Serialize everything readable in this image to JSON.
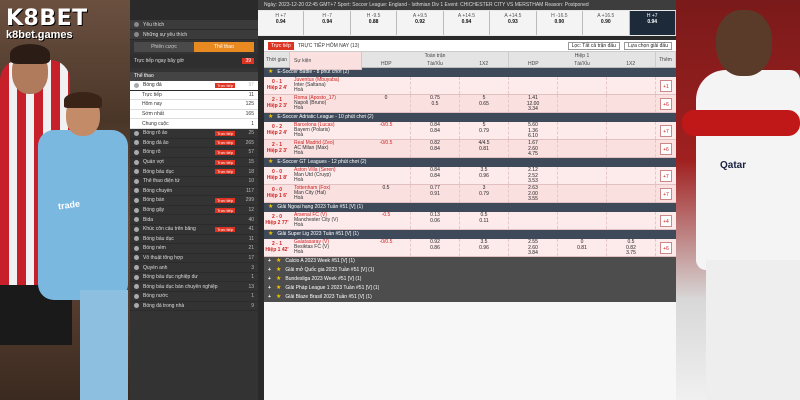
{
  "brand": {
    "name_k8": "K8",
    "name_bet": "BET",
    "domain": "k8bet.games"
  },
  "photo": {
    "left_sponsor": "trade",
    "right_sponsor": "Qatar"
  },
  "topbar": {
    "info": "Ngày: 2023-12-20 02:45 GMT+7 Sport: Soccer League: England - Isthmian Div 1 Event: CHICHESTER CITY VS MERSTHAM Reason: Postponed",
    "odds": [
      {
        "l": "H +7",
        "v": "0.94"
      },
      {
        "l": "H -7",
        "v": "0.94"
      },
      {
        "l": "H -9.5",
        "v": "0.88"
      },
      {
        "l": "A +9.5",
        "v": "0.92"
      },
      {
        "l": "A +14.5",
        "v": "0.94"
      },
      {
        "l": "A +14.5",
        "v": "0.93"
      },
      {
        "l": "H -16.5",
        "v": "0.90"
      },
      {
        "l": "A +16.5",
        "v": "0.90"
      },
      {
        "l": "H +7",
        "v": "0.94"
      }
    ]
  },
  "sidebar": {
    "favorites": "Yêu thích",
    "favorite_sports": "Những sự yêu thích",
    "tab_left": "Phiên cược",
    "tab_right": "Thể thao",
    "live_label": "Trực tiếp ngay bây giờ",
    "live_count": "39",
    "section": "Thể thao",
    "sport_selected": {
      "name": "Bóng đá",
      "live": "Trực tiếp",
      "count": "97"
    },
    "sub_items": [
      {
        "name": "Trực tiếp",
        "count": "11"
      },
      {
        "name": "Hôm nay",
        "count": "125"
      },
      {
        "name": "Sớm nhất",
        "count": "165"
      },
      {
        "name": "Chung cuộc",
        "count": "1"
      }
    ],
    "sports": [
      {
        "name": "Bóng rổ ảo",
        "live": "Trực tiếp",
        "count": "25"
      },
      {
        "name": "Bóng đá ảo",
        "live": "Trực tiếp",
        "count": "265"
      },
      {
        "name": "Bóng rổ",
        "live": "Trực tiếp",
        "count": "57"
      },
      {
        "name": "Quần vợt",
        "live": "Trực tiếp",
        "count": "15"
      },
      {
        "name": "Bóng bầu dục",
        "live": "Trực tiếp",
        "count": "18"
      },
      {
        "name": "Thể thao điện tử",
        "live": "",
        "count": "10"
      },
      {
        "name": "Bóng chuyền",
        "live": "",
        "count": "117"
      },
      {
        "name": "Bóng bàn",
        "live": "Trực tiếp",
        "count": "299"
      },
      {
        "name": "Bóng gậy",
        "live": "Trực tiếp",
        "count": "12"
      },
      {
        "name": "Bida",
        "live": "",
        "count": "40"
      },
      {
        "name": "Khúc côn cầu trên băng",
        "live": "Trực tiếp",
        "count": "41"
      },
      {
        "name": "Bóng bầu dục",
        "live": "",
        "count": "11"
      },
      {
        "name": "Bóng ném",
        "live": "",
        "count": "21"
      },
      {
        "name": "Vô thuật tổng hợp",
        "live": "",
        "count": "17"
      },
      {
        "name": "Quyền anh",
        "live": "",
        "count": "3"
      },
      {
        "name": "Bóng bầu dục nghiệp dư",
        "live": "",
        "count": "1"
      },
      {
        "name": "Bóng bầu dục bán chuyên nghiệp",
        "live": "",
        "count": "13"
      },
      {
        "name": "Bóng nước",
        "live": "",
        "count": "1"
      },
      {
        "name": "Bóng đá trong nhà",
        "live": "",
        "count": "9"
      }
    ]
  },
  "main": {
    "live_btn": "Trực tiếp",
    "title": "TRỰC TIẾP HÔM NAY (13)",
    "select": "Lọc: Tất cả trận đấu",
    "filter": "Lựa chọn giải đấu",
    "col_time": "Thời gian",
    "col_match": "Sự kiện",
    "col_ft": "Toàn trận",
    "col_h1": "Hiệp 1",
    "sub_cols": [
      "HDP",
      "Tài/Xỉu",
      "1X2",
      "HDP",
      "Tài/Xỉu",
      "1X2"
    ],
    "col_more": "Thêm",
    "leagues": [
      {
        "name": "E-Soccer Battle - 8 phút chơi (2)",
        "matches": [
          {
            "time": "0 - 1",
            "min": "Hiệp 2 4'",
            "home": "Juventus (Mbuyaba)",
            "away": "Inter (Saltana)",
            "draw": "Hoà",
            "o": [
              [
                "",
                "",
                ""
              ],
              [
                "",
                "",
                ""
              ],
              [
                "",
                "",
                ""
              ],
              [
                "",
                "",
                ""
              ],
              [
                "",
                "",
                ""
              ],
              [
                "",
                "",
                ""
              ]
            ],
            "more": "+1"
          },
          {
            "time": "2 - 1",
            "min": "Hiệp 2 3'",
            "home": "Roma (Aposto_17)",
            "away": "Napoli (Bruno)",
            "draw": "Hoà",
            "o": [
              [
                "0",
                "",
                ""
              ],
              [
                "0.75",
                "0.5",
                ""
              ],
              [
                "5",
                "0.65",
                ""
              ],
              [
                "1.41",
                "12.00",
                "3.34"
              ],
              [
                "",
                "",
                ""
              ],
              [
                "",
                "",
                ""
              ]
            ],
            "more": "+6"
          }
        ]
      },
      {
        "name": "E-Soccer Adriatic League - 10 phút chơi (2)",
        "matches": [
          {
            "time": "0 - 2",
            "min": "Hiệp 2 4'",
            "home": "Barcelona (Lucas)",
            "away": "Bayern (Polaris)",
            "draw": "Hoà",
            "o": [
              [
                "-0/0.5",
                "",
                ""
              ],
              [
                "0.84",
                "0.84",
                ""
              ],
              [
                "5",
                "0.79",
                ""
              ],
              [
                "5.60",
                "1.36",
                "6.10"
              ],
              [
                "",
                "",
                ""
              ],
              [
                "",
                "",
                ""
              ]
            ],
            "more": "+7"
          },
          {
            "time": "2 - 1",
            "min": "Hiệp 2 3'",
            "home": "Real Madrid (Zeo)",
            "away": "AC Milan (Max)",
            "draw": "Hoà",
            "o": [
              [
                "-0/0.5",
                "",
                ""
              ],
              [
                "0.82",
                "0.84",
                ""
              ],
              [
                "4/4.5",
                "0.81",
                ""
              ],
              [
                "1.67",
                "2.60",
                "4.75"
              ],
              [
                "",
                "",
                ""
              ],
              [
                "",
                "",
                ""
              ]
            ],
            "more": "+6"
          }
        ]
      },
      {
        "name": "E-Soccer GT Leagues - 12 phút chơi (2)",
        "matches": [
          {
            "time": "0 - 0",
            "min": "Hiệp 1 8'",
            "home": "Aston Villa (Seren)",
            "away": "Man Utd (Cruyp)",
            "draw": "Hoà",
            "o": [
              [
                "",
                "",
                ""
              ],
              [
                "0.84",
                "0.84",
                ""
              ],
              [
                "3.5",
                "0.96",
                ""
              ],
              [
                "2.12",
                "2.52",
                "3.53"
              ],
              [
                "",
                "",
                ""
              ],
              [
                "",
                "",
                ""
              ]
            ],
            "more": "+7"
          },
          {
            "time": "0 - 0",
            "min": "Hiệp 1 6'",
            "home": "Tottenham (Fox)",
            "away": "Man City (Hal)",
            "draw": "Hoà",
            "o": [
              [
                "0.5",
                "",
                ""
              ],
              [
                "0.77",
                "0.91",
                ""
              ],
              [
                "3",
                "0.79",
                ""
              ],
              [
                "2.63",
                "2.00",
                "3.55"
              ],
              [
                "",
                "",
                ""
              ],
              [
                "",
                "",
                ""
              ]
            ],
            "more": "+7"
          }
        ]
      },
      {
        "name": "Giải Ngoại hạng 2023 Tuần #51 [V] (1)",
        "matches": [
          {
            "time": "2 - 0",
            "min": "Hiệp 2 77'",
            "home": "Arsenal FC (V)",
            "away": "Manchester City (V)",
            "draw": "Hoà",
            "o": [
              [
                "-0.5",
                "",
                ""
              ],
              [
                "0.13",
                "0.06",
                ""
              ],
              [
                "0.5",
                "0.11",
                ""
              ],
              [
                "",
                "",
                ""
              ],
              [
                "",
                "",
                ""
              ],
              [
                "",
                "",
                ""
              ]
            ],
            "more": "+4"
          }
        ]
      },
      {
        "name": "Giải Super Lig 2023 Tuần #51 [V] (1)",
        "matches": [
          {
            "time": "2 - 1",
            "min": "Hiệp 1 42'",
            "home": "Galatasaray (V)",
            "away": "Besiktas FC (V)",
            "draw": "Hoà",
            "o": [
              [
                "-0/0.5",
                "",
                ""
              ],
              [
                "0.92",
                "0.86",
                ""
              ],
              [
                "3.5",
                "0.96",
                ""
              ],
              [
                "2.55",
                "2.60",
                "3.84"
              ],
              [
                "0",
                "0.81",
                ""
              ],
              [
                "0.5",
                "0.82",
                "3.75"
              ]
            ],
            "more": "+6"
          }
        ]
      }
    ],
    "collapsed": [
      "Calcio A 2023 Week #51 [V] (1)",
      "Giải mở Quốc gia 2023 Tuần #51 [V] (1)",
      "Bundesliga 2023 Week #51 [V] (1)",
      "Giải Pháp League 1 2023 Tuần #51 [V] (1)",
      "Giải Blaze Brasil 2023 Tuần #51 [V] (1)"
    ]
  }
}
